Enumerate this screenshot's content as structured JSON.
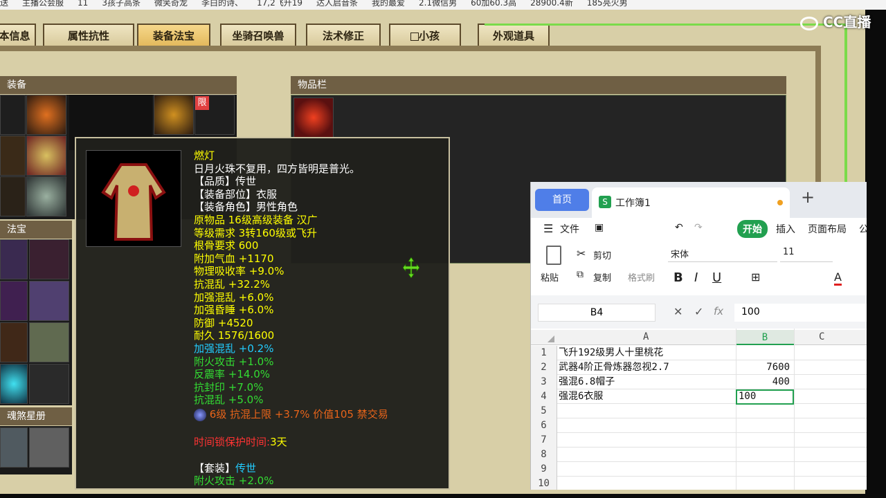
{
  "bookmarks": [
    "送",
    "主播公会服",
    "11",
    "3孩子高条",
    "微笑奇龙",
    "李白的诗、",
    "17,2飞升19",
    "达人启音条",
    "我的最爱",
    "2.1微信男",
    "60加60.3高",
    "28900.4新",
    "185亮火男"
  ],
  "watermark": "CC直播",
  "tabs": [
    "本信息",
    "属性抗性",
    "装备法宝",
    "坐骑召唤兽",
    "法术修正",
    "小孩",
    "外观道具"
  ],
  "panels": {
    "equipment": "装备",
    "treasure": "法宝",
    "inventory": "物品栏",
    "star_book": "魂煞星册",
    "limit_badge": "限"
  },
  "tooltip": {
    "lines": [
      {
        "text": "燃灯",
        "color": "y"
      },
      {
        "text": "日月火珠不复用，四方皆明是普光。",
        "color": "w"
      },
      {
        "text": "【品质】传世",
        "color": "w"
      },
      {
        "text": "【装备部位】衣服",
        "color": "w"
      },
      {
        "text": "【装备角色】男性角色",
        "color": "w"
      },
      {
        "text": "原物品 16级高级装备 汉广",
        "color": "y"
      },
      {
        "text": "等级需求 3转160级或飞升",
        "color": "y"
      },
      {
        "text": "根骨要求 600",
        "color": "y"
      },
      {
        "text": "附加气血 +1170",
        "color": "y"
      },
      {
        "text": "物理吸收率 +9.0%",
        "color": "y"
      },
      {
        "text": "抗混乱 +32.2%",
        "color": "y"
      },
      {
        "text": "加强混乱 +6.0%",
        "color": "y"
      },
      {
        "text": "加强昏睡 +6.0%",
        "color": "y"
      },
      {
        "text": "防御 +4520",
        "color": "y"
      },
      {
        "text": "耐久 1576/1600",
        "color": "y"
      },
      {
        "text": "加强混乱 +0.2%",
        "color": "c"
      },
      {
        "text": "附火攻击 +1.0%",
        "color": "g"
      },
      {
        "text": "反震率 +14.0%",
        "color": "g"
      },
      {
        "text": "抗封印 +7.0%",
        "color": "g"
      },
      {
        "text": "抗混乱 +5.0%",
        "color": "g"
      }
    ],
    "gem_line": "6级 抗混上限 +3.7% 价值105 禁交易",
    "lock_label": "时间锁保护时间:",
    "lock_value": "3天",
    "set_label": "【套装】",
    "set_value": "传世",
    "set_bonus": "附火攻击 +2.0%"
  },
  "wps": {
    "home_tab": "首页",
    "doc_name": "工作簿1",
    "add_tab": "+",
    "menu": {
      "file": "文件",
      "start": "开始",
      "insert": "插入",
      "layout": "页面布局",
      "more": "公"
    },
    "ribbon": {
      "paste": "粘贴",
      "cut": "剪切",
      "copy": "复制",
      "format_painter": "格式刷",
      "font": "宋体",
      "size": "11",
      "bold": "B",
      "italic": "I",
      "underline": "U"
    },
    "cell_ref": "B4",
    "fx": "fx",
    "formula": "100",
    "col_a": "A",
    "col_b": "B",
    "col_c": "C",
    "rows": [
      {
        "n": "1",
        "a": "飞升192级男人十里桃花",
        "b": ""
      },
      {
        "n": "2",
        "a": "武器4阶正骨炼器忽视2.7",
        "b": "7600"
      },
      {
        "n": "3",
        "a": "强混6.8帽子",
        "b": "400"
      },
      {
        "n": "4",
        "a": "强混6衣服",
        "b": "100"
      },
      {
        "n": "5",
        "a": "",
        "b": ""
      },
      {
        "n": "6",
        "a": "",
        "b": ""
      },
      {
        "n": "7",
        "a": "",
        "b": ""
      },
      {
        "n": "8",
        "a": "",
        "b": ""
      },
      {
        "n": "9",
        "a": "",
        "b": ""
      },
      {
        "n": "10",
        "a": "",
        "b": ""
      }
    ]
  }
}
